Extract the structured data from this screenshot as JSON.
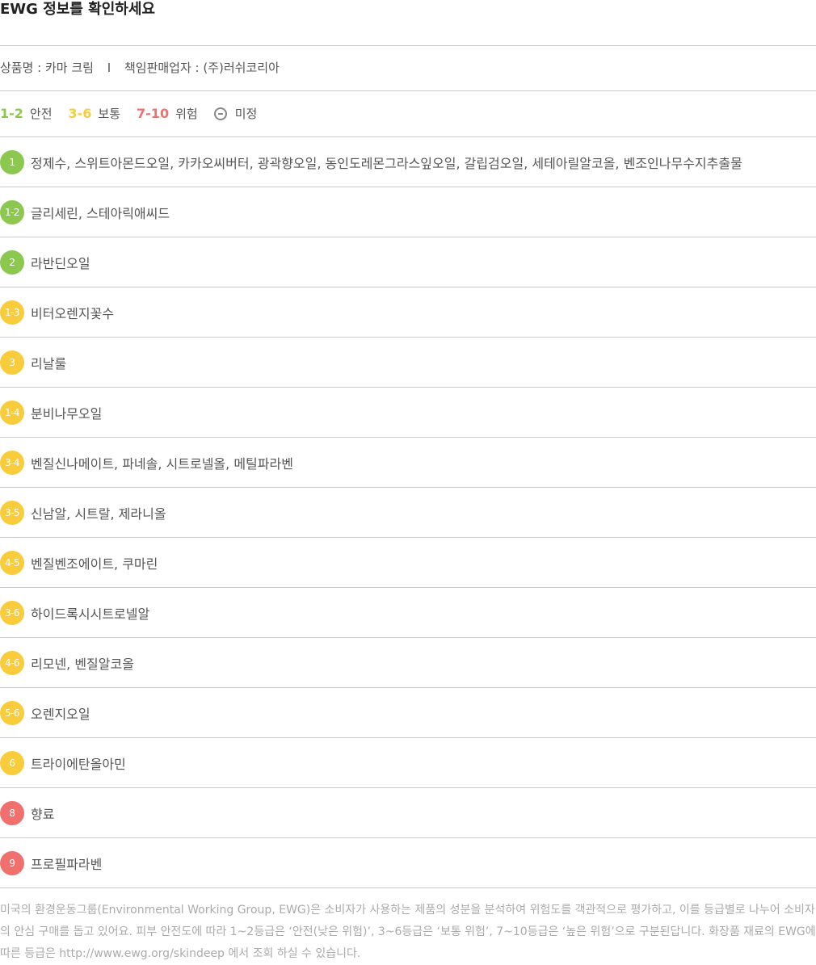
{
  "header": {
    "title": "EWG 정보를 확인하세요"
  },
  "product": {
    "name_text": "상품명 : 카마 크림",
    "separator": "I",
    "seller_text": "책임판매업자 : (주)러쉬코리아"
  },
  "legend": {
    "safe_range": "1-2",
    "safe_label": "안전",
    "moderate_range": "3-6",
    "moderate_label": "보통",
    "high_range": "7-10",
    "high_label": "위험",
    "undecided_label": "미정",
    "colors": {
      "safe": "#8cc850",
      "moderate": "#f8cc3b",
      "high": "#f0706e",
      "undecided": "#888888"
    }
  },
  "ingredients": [
    {
      "grade": "1",
      "level": "safe",
      "names": "정제수, 스위트아몬드오일, 카카오씨버터, 광곽향오일, 동인도레몬그라스잎오일, 갈립검오일, 세테아릴알코올, 벤조인나무수지추출물"
    },
    {
      "grade": "1-2",
      "level": "safe",
      "names": "글리세린, 스테아릭애씨드"
    },
    {
      "grade": "2",
      "level": "safe",
      "names": "라반딘오일"
    },
    {
      "grade": "1-3",
      "level": "moderate",
      "names": "비터오렌지꽃수"
    },
    {
      "grade": "3",
      "level": "moderate",
      "names": "리날룰"
    },
    {
      "grade": "1-4",
      "level": "moderate",
      "names": "분비나무오일"
    },
    {
      "grade": "3-4",
      "level": "moderate",
      "names": "벤질신나메이트, 파네솔, 시트로넬올, 메틸파라벤"
    },
    {
      "grade": "3-5",
      "level": "moderate",
      "names": "신남알, 시트랄, 제라니올"
    },
    {
      "grade": "4-5",
      "level": "moderate",
      "names": "벤질벤조에이트, 쿠마린"
    },
    {
      "grade": "3-6",
      "level": "moderate",
      "names": "하이드록시시트로넬알"
    },
    {
      "grade": "4-6",
      "level": "moderate",
      "names": "리모넨, 벤질알코올"
    },
    {
      "grade": "5-6",
      "level": "moderate",
      "names": "오렌지오일"
    },
    {
      "grade": "6",
      "level": "moderate",
      "names": "트라이에탄올아민"
    },
    {
      "grade": "8",
      "level": "high",
      "names": "향료"
    },
    {
      "grade": "9",
      "level": "high",
      "names": "프로필파라벤"
    }
  ],
  "footnote": {
    "text": "미국의 환경운동그룹(Environmental Working Group, EWG)은 소비자가 사용하는 제품의 성분을 분석하여 위험도를 객관적으로 평가하고, 이를 등급별로 나누어 소비자의 안심 구매를 돕고 있어요. 피부 안전도에 따라 1~2등급은 ‘안전(낮은 위험)’, 3~6등급은 ‘보통 위험’, 7~10등급은 ‘높은 위험’으로 구분된답니다. 화장품 재료의 EWG에 따른 등급은 http://www.ewg.org/skindeep 에서 조회 하실 수 있습니다."
  }
}
